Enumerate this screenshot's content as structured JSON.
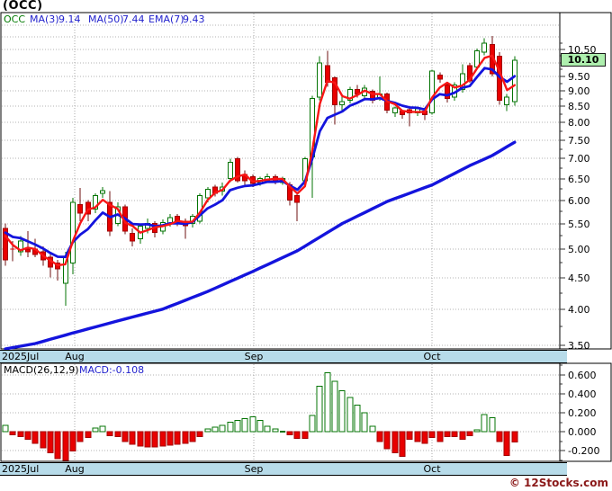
{
  "header": {
    "title": "(OCC)"
  },
  "price_panel": {
    "legend": {
      "symbol": "OCC",
      "ma3_label": "MA(3)",
      "ma3_value": "9.14",
      "ma50_label": "MA(50)",
      "ma50_value": "7.44",
      "ema7_label": "EMA(7)",
      "ema7_value": "9.43"
    },
    "last_price_badge": "10.10"
  },
  "macd_panel": {
    "label": "MACD(26,12,9)",
    "current": "MACD:-0.108"
  },
  "time_axis": {
    "labels": [
      "2025Jul",
      "Aug",
      "Sep",
      "Oct"
    ]
  },
  "footer": {
    "watermark": "© 12Stocks.com"
  },
  "colors": {
    "up": "#047404",
    "down": "#e80000",
    "down_border": "#a30000",
    "down_wick": "#6f1111",
    "ma3": "#f81616",
    "ema7": "#1414dd",
    "ma50": "#1414dd",
    "grid": "#b3b3b3",
    "frame": "#000000",
    "band_bg": "#b7dbe9",
    "badge_bg": "#aeefae",
    "legend_green": "#007a00",
    "legend_blue": "#2222cc",
    "watermark": "#8b1a1a"
  },
  "chart_data": [
    {
      "type": "candlestick",
      "title": "OCC daily price with MA(3), MA(50), EMA(7)",
      "scale": "log",
      "ylim": [
        3.45,
        12.05
      ],
      "y_ticks_min": 3.5,
      "y_ticks_max": 10.5,
      "y_tick_step": 0.5,
      "grid": true,
      "last_close": 10.1,
      "start_label": "2025Jul",
      "months": [
        {
          "label": "Aug",
          "index": 9.3
        },
        {
          "label": "Sep",
          "index": 33.2
        },
        {
          "label": "Oct",
          "index": 57.0
        }
      ],
      "prior_closes": [
        5.5,
        5.45
      ],
      "candles": [
        [
          5.4,
          5.5,
          4.7,
          4.8
        ],
        [
          5.0,
          5.15,
          4.78,
          4.98
        ],
        [
          4.95,
          5.25,
          4.88,
          5.15
        ],
        [
          5.0,
          5.35,
          4.85,
          4.95
        ],
        [
          5.0,
          5.2,
          4.85,
          4.9
        ],
        [
          4.95,
          5.05,
          4.7,
          4.8
        ],
        [
          4.85,
          4.95,
          4.5,
          4.68
        ],
        [
          4.75,
          4.8,
          4.45,
          4.65
        ],
        [
          4.4,
          4.95,
          4.05,
          4.85
        ],
        [
          4.75,
          6.05,
          4.55,
          5.95
        ],
        [
          5.9,
          6.28,
          5.55,
          5.72
        ],
        [
          5.95,
          6.0,
          5.55,
          5.7
        ],
        [
          5.8,
          6.15,
          5.72,
          6.1
        ],
        [
          6.15,
          6.3,
          6.05,
          6.22
        ],
        [
          5.95,
          6.2,
          5.25,
          5.35
        ],
        [
          5.5,
          5.95,
          5.45,
          5.85
        ],
        [
          5.85,
          5.9,
          5.28,
          5.35
        ],
        [
          5.3,
          5.4,
          5.05,
          5.15
        ],
        [
          5.2,
          5.5,
          5.1,
          5.45
        ],
        [
          5.4,
          5.6,
          5.3,
          5.5
        ],
        [
          5.5,
          5.55,
          5.22,
          5.32
        ],
        [
          5.35,
          5.58,
          5.28,
          5.52
        ],
        [
          5.5,
          5.7,
          5.44,
          5.62
        ],
        [
          5.65,
          5.7,
          5.45,
          5.52
        ],
        [
          5.55,
          5.6,
          5.2,
          5.45
        ],
        [
          5.5,
          5.7,
          5.42,
          5.65
        ],
        [
          5.55,
          6.15,
          5.5,
          6.1
        ],
        [
          6.05,
          6.3,
          5.95,
          6.25
        ],
        [
          6.3,
          6.35,
          6.08,
          6.15
        ],
        [
          6.2,
          6.4,
          6.1,
          6.3
        ],
        [
          6.5,
          7.0,
          6.42,
          6.9
        ],
        [
          7.0,
          7.05,
          6.4,
          6.45
        ],
        [
          6.6,
          6.7,
          6.35,
          6.45
        ],
        [
          6.55,
          6.6,
          6.3,
          6.38
        ],
        [
          6.4,
          6.55,
          6.33,
          6.5
        ],
        [
          6.45,
          6.62,
          6.4,
          6.55
        ],
        [
          6.55,
          6.6,
          6.36,
          6.42
        ],
        [
          6.4,
          6.55,
          6.35,
          6.5
        ],
        [
          6.35,
          6.42,
          5.88,
          6.0
        ],
        [
          6.1,
          6.15,
          5.55,
          5.95
        ],
        [
          6.45,
          7.05,
          6.38,
          7.0
        ],
        [
          7.05,
          8.85,
          6.05,
          8.75
        ],
        [
          8.8,
          10.25,
          8.7,
          10.0
        ],
        [
          9.9,
          10.45,
          9.15,
          9.3
        ],
        [
          9.45,
          9.5,
          7.95,
          8.55
        ],
        [
          8.55,
          8.85,
          8.35,
          8.65
        ],
        [
          8.7,
          9.15,
          8.6,
          9.05
        ],
        [
          9.05,
          9.2,
          8.78,
          8.9
        ],
        [
          8.85,
          9.2,
          8.75,
          9.1
        ],
        [
          9.0,
          9.05,
          8.6,
          8.7
        ],
        [
          8.75,
          9.5,
          8.68,
          8.9
        ],
        [
          8.9,
          8.95,
          8.28,
          8.38
        ],
        [
          8.3,
          8.5,
          8.18,
          8.45
        ],
        [
          8.35,
          8.4,
          8.12,
          8.25
        ],
        [
          8.4,
          8.45,
          7.9,
          8.3
        ],
        [
          8.3,
          8.5,
          8.2,
          8.42
        ],
        [
          8.35,
          8.42,
          8.08,
          8.25
        ],
        [
          8.3,
          9.75,
          8.24,
          9.7
        ],
        [
          9.55,
          9.65,
          9.28,
          9.4
        ],
        [
          9.2,
          9.25,
          8.62,
          8.75
        ],
        [
          8.8,
          9.3,
          8.68,
          9.2
        ],
        [
          9.05,
          9.95,
          8.95,
          9.6
        ],
        [
          9.9,
          10.0,
          9.28,
          9.35
        ],
        [
          9.85,
          10.55,
          9.75,
          10.45
        ],
        [
          10.4,
          10.95,
          10.28,
          10.75
        ],
        [
          10.7,
          11.05,
          9.5,
          9.6
        ],
        [
          10.25,
          10.4,
          8.55,
          8.7
        ],
        [
          8.55,
          8.9,
          8.35,
          8.8
        ],
        [
          8.65,
          10.25,
          8.52,
          10.1
        ]
      ],
      "overlays": [
        {
          "name": "MA(3)",
          "display_value": 9.14,
          "derive": "sma",
          "window": 3
        },
        {
          "name": "EMA(7)",
          "display_value": 9.43,
          "derive": "ema",
          "window": 7
        },
        {
          "name": "MA(50)",
          "display_value": 7.44,
          "derive": "anchors",
          "anchors": [
            [
              0,
              3.45
            ],
            [
              4,
              3.52
            ],
            [
              9,
              3.66
            ],
            [
              14,
              3.8
            ],
            [
              21,
              4.0
            ],
            [
              27,
              4.27
            ],
            [
              33,
              4.6
            ],
            [
              39,
              4.97
            ],
            [
              45,
              5.5
            ],
            [
              51,
              5.97
            ],
            [
              57,
              6.35
            ],
            [
              62,
              6.82
            ],
            [
              65,
              7.08
            ],
            [
              68,
              7.44
            ]
          ]
        }
      ]
    },
    {
      "type": "bar",
      "title": "MACD(26,12,9) histogram",
      "ylim": [
        -0.31,
        0.72
      ],
      "y_ticks": [
        0.6,
        0.4,
        0.2,
        0.0,
        -0.2
      ],
      "grid": true,
      "current_macd": -0.108,
      "values": [
        0.07,
        -0.03,
        -0.05,
        -0.08,
        -0.12,
        -0.17,
        -0.22,
        -0.28,
        -0.3,
        -0.2,
        -0.1,
        -0.06,
        0.04,
        0.06,
        -0.04,
        -0.05,
        -0.1,
        -0.13,
        -0.15,
        -0.16,
        -0.16,
        -0.15,
        -0.14,
        -0.13,
        -0.12,
        -0.1,
        -0.05,
        0.03,
        0.05,
        0.07,
        0.1,
        0.12,
        0.14,
        0.16,
        0.12,
        0.06,
        0.03,
        0.01,
        -0.03,
        -0.07,
        -0.07,
        0.17,
        0.48,
        0.62,
        0.53,
        0.43,
        0.36,
        0.28,
        0.2,
        0.06,
        -0.1,
        -0.18,
        -0.22,
        -0.26,
        -0.08,
        -0.1,
        -0.12,
        -0.06,
        -0.1,
        -0.05,
        -0.05,
        -0.08,
        -0.04,
        0.02,
        0.18,
        0.15,
        -0.1,
        -0.25,
        -0.108
      ]
    }
  ]
}
